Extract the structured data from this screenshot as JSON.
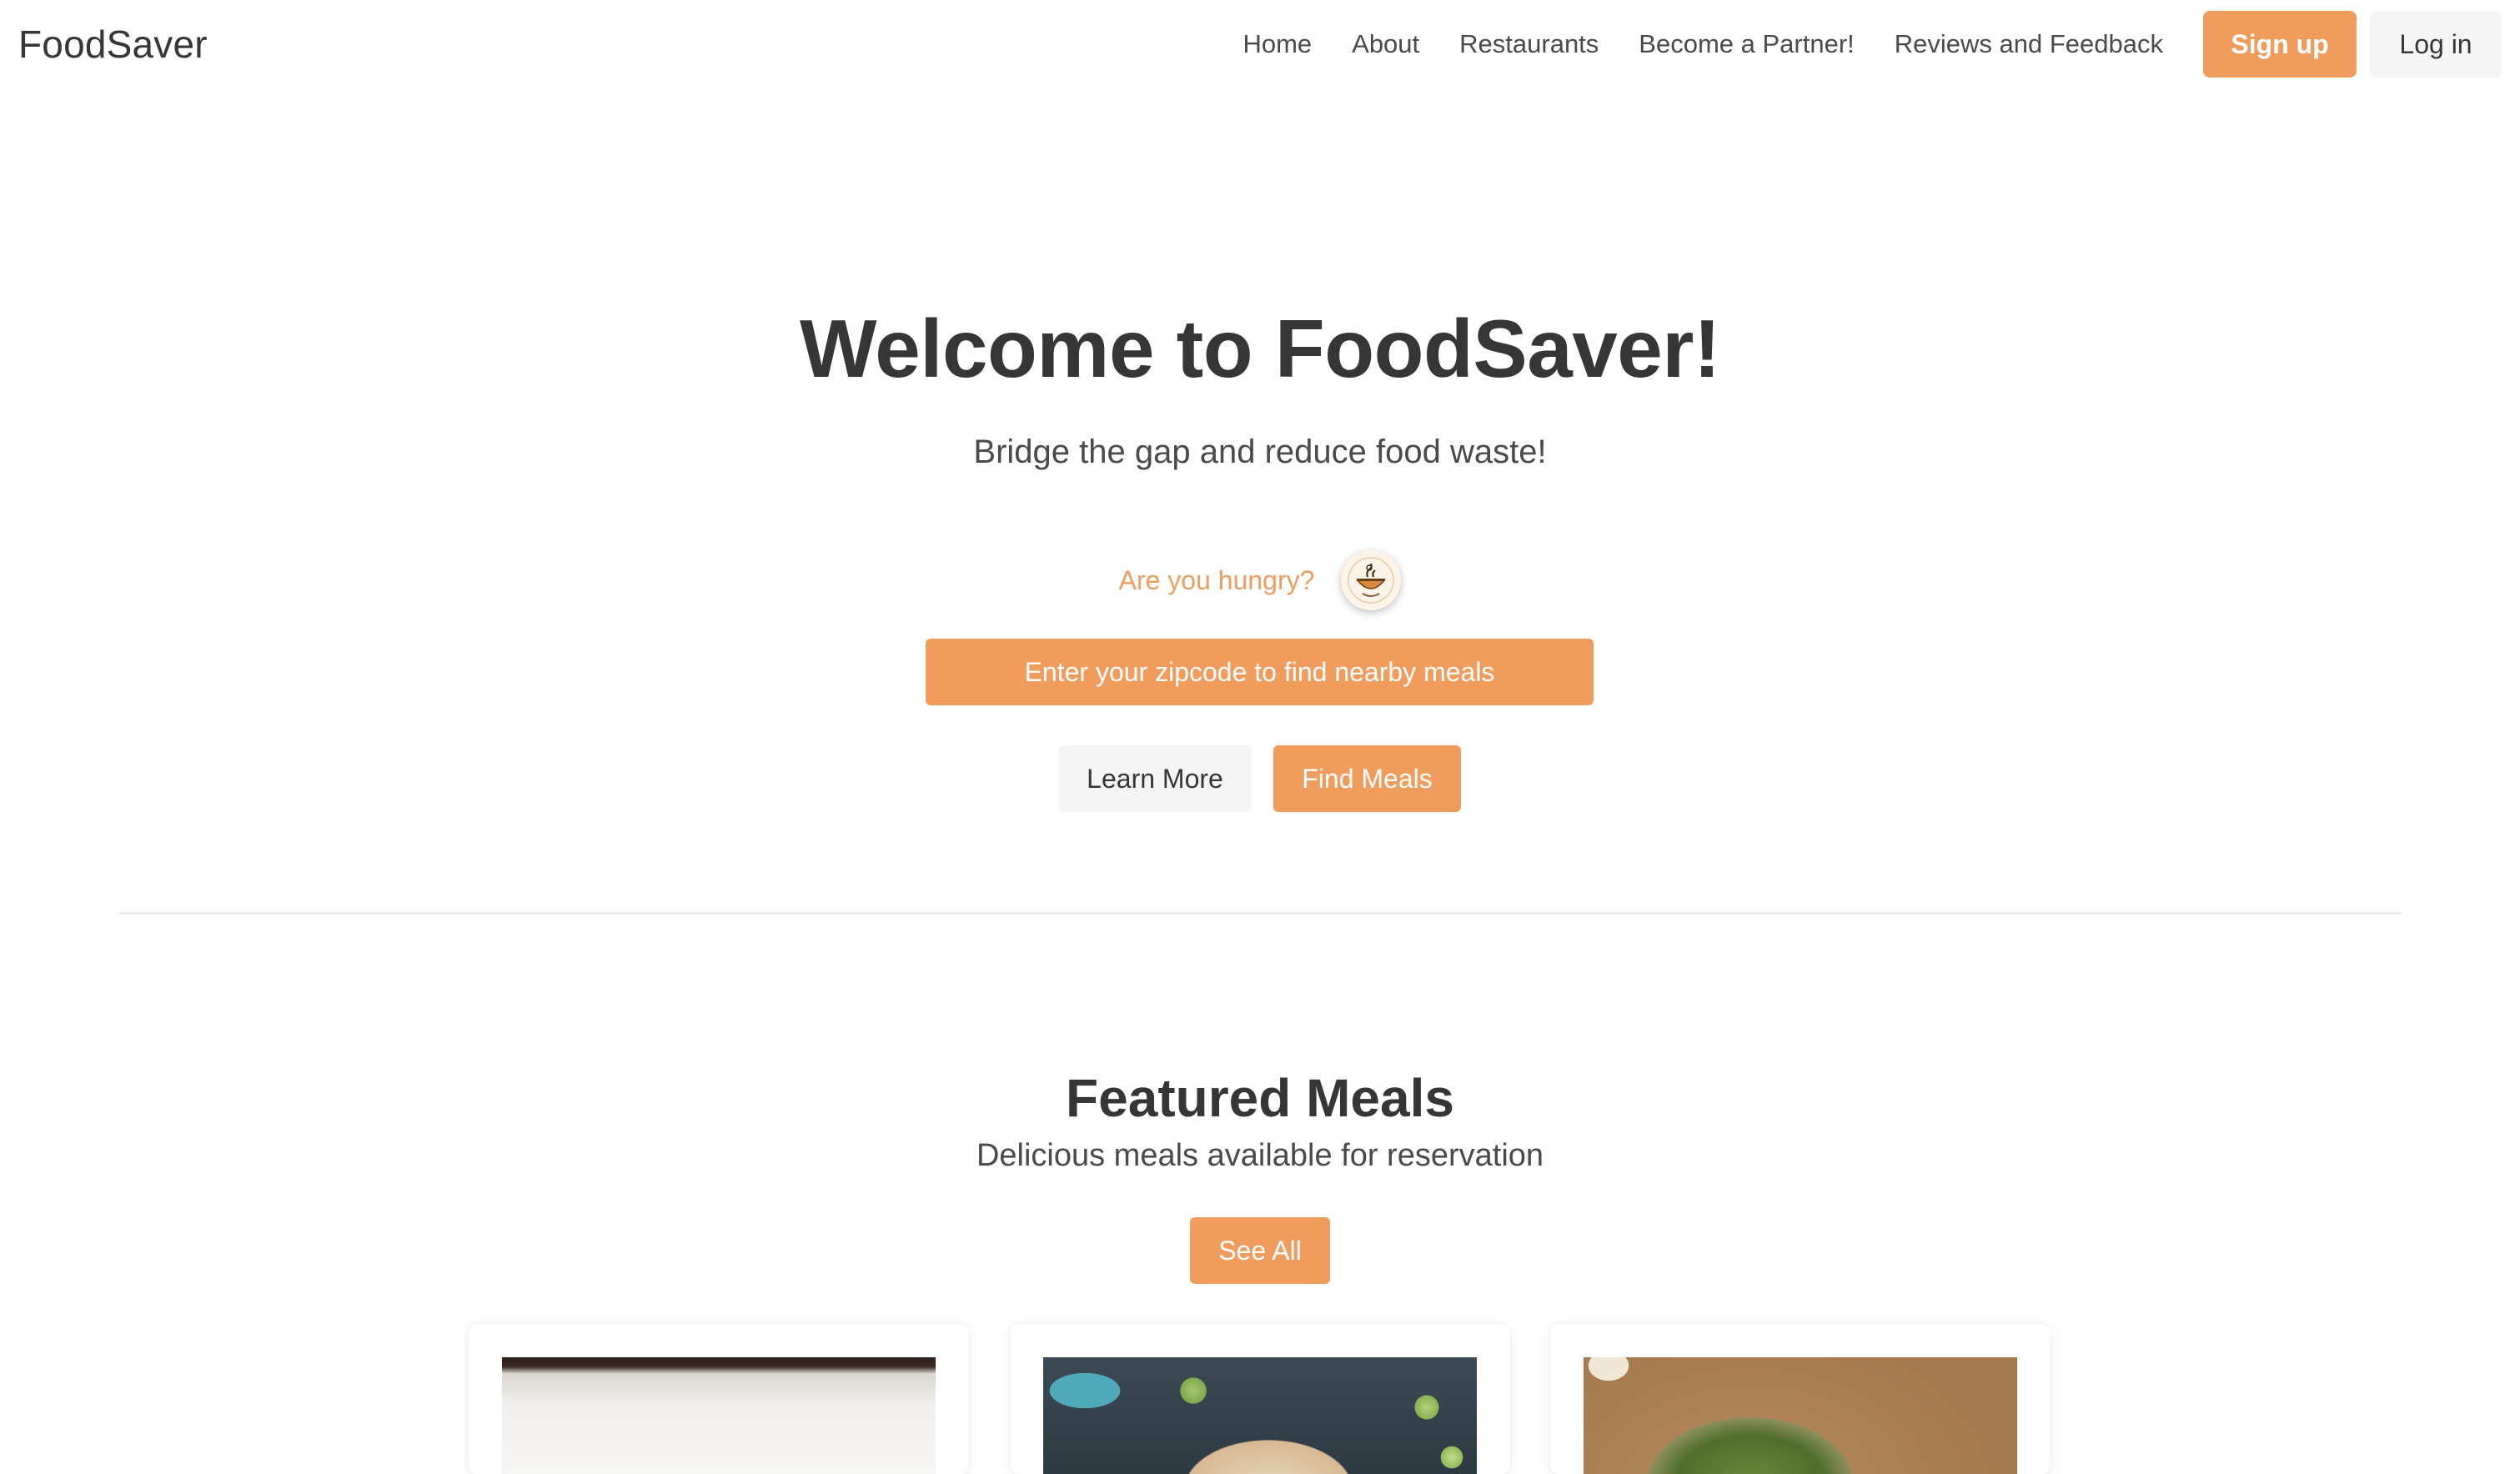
{
  "brand": "FoodSaver",
  "nav": {
    "links": [
      "Home",
      "About",
      "Restaurants",
      "Become a Partner!",
      "Reviews and Feedback"
    ],
    "signup": "Sign up",
    "login": "Log in"
  },
  "hero": {
    "title": "Welcome to FoodSaver!",
    "subtitle": "Bridge the gap and reduce food waste!",
    "hungry": "Are you hungry?",
    "zip_button": "Enter your zipcode to find nearby meals",
    "learn_more": "Learn More",
    "find_meals": "Find Meals"
  },
  "featured": {
    "title": "Featured Meals",
    "subtitle": "Delicious meals available for reservation",
    "see_all": "See All"
  },
  "colors": {
    "accent": "#f09c5c",
    "light_button": "#f5f5f5",
    "text": "#363636"
  },
  "icons": {
    "logo": "bowl-logo-icon"
  }
}
